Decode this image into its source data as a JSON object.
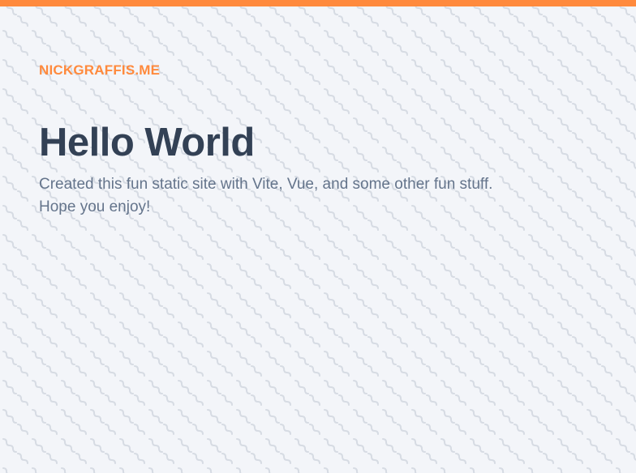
{
  "header": {
    "site_link": "NICKGRAFFIS.ME"
  },
  "main": {
    "title": "Hello World",
    "intro_line1": "Created this fun static site with Vite, Vue, and some other fun stuff.",
    "intro_line2": "Hope you enjoy!"
  },
  "colors": {
    "accent": "#ff8a3d",
    "title": "#334155",
    "body_text": "#64748b",
    "background": "#f3f5f9",
    "pattern": "#d6dbe3"
  }
}
